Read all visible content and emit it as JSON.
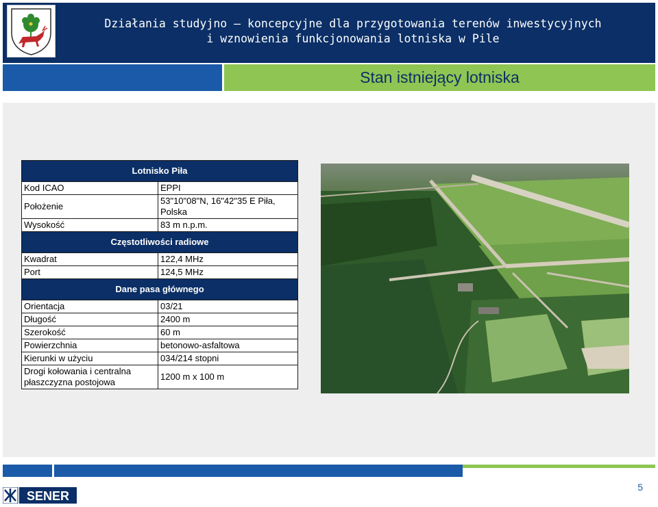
{
  "header": {
    "title_line1": "Działania studyjno – koncepcyjne dla przygotowania terenów inwestycyjnych",
    "title_line2": "i wznowienia funkcjonowania lotniska w Pile"
  },
  "subtitle": "Stan istniejący lotniska",
  "table": {
    "section1_title": "Lotnisko Piła",
    "rows1": [
      {
        "label": "Kod ICAO",
        "value": "EPPI"
      },
      {
        "label": "Położenie",
        "value": "53\"10\"08\"N, 16\"42\"35 E Piła, Polska"
      },
      {
        "label": "Wysokość",
        "value": "83 m n.p.m."
      }
    ],
    "section2_title": "Częstotliwości radiowe",
    "rows2": [
      {
        "label": "Kwadrat",
        "value": "122,4 MHz"
      },
      {
        "label": "Port",
        "value": "124,5 MHz"
      }
    ],
    "section3_title": "Dane pasa głównego",
    "rows3": [
      {
        "label": "Orientacja",
        "value": "03/21"
      },
      {
        "label": "Długość",
        "value": "2400 m"
      },
      {
        "label": "Szerokość",
        "value": "60 m"
      },
      {
        "label": "Powierzchnia",
        "value": "betonowo-asfaltowa"
      },
      {
        "label": "Kierunki w użyciu",
        "value": "034/214 stopni"
      },
      {
        "label": "Drogi kołowania i centralna płaszczyzna postojowa",
        "value": "1200 m x 100 m"
      }
    ]
  },
  "footer": {
    "page_number": "5",
    "logo_text": "SENER"
  },
  "colors": {
    "navy": "#0b2f66",
    "blue": "#1a5aa8",
    "green": "#8fc553"
  }
}
